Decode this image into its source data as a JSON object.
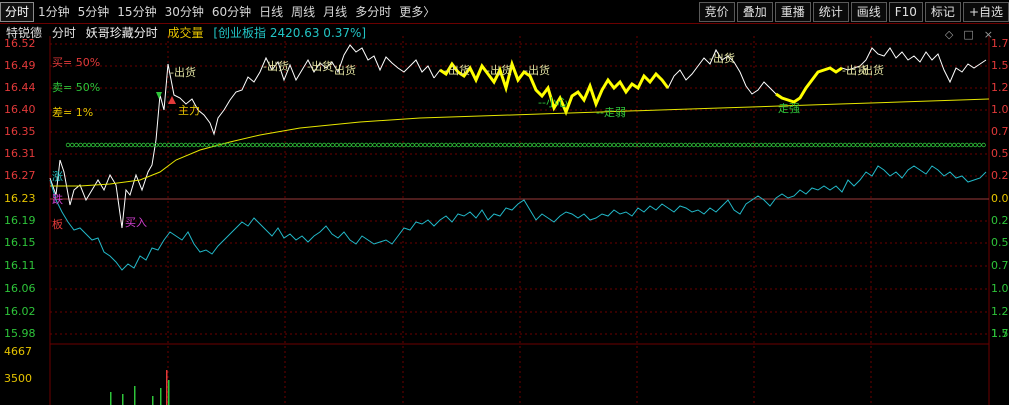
{
  "tabs": [
    "分时",
    "1分钟",
    "5分钟",
    "15分钟",
    "30分钟",
    "60分钟",
    "日线",
    "周线",
    "月线",
    "多分时",
    "更多〉"
  ],
  "tools": [
    "竞价",
    "叠加",
    "重播",
    "统计",
    "画线",
    "F10",
    "标记",
    "+自选"
  ],
  "header": {
    "stock_name": "特锐德",
    "period": "分时",
    "indicator": "妖哥珍藏分时",
    "volume_label": "成交量",
    "index_info": "[创业板指 2420.63 0.37%]"
  },
  "window_buttons": [
    "◇",
    "□",
    "×"
  ],
  "price_axis": {
    "labels": [
      "16.52",
      "16.49",
      "16.44",
      "16.40",
      "16.35",
      "16.31",
      "16.27",
      "16.23",
      "16.19",
      "16.15",
      "16.11",
      "16.06",
      "16.02",
      "15.98"
    ],
    "colors": {
      "up": "#e23a3a",
      "base": "#e6c400",
      "down": "#2ec43a"
    }
  },
  "volume_axis": {
    "labels": [
      "4667",
      "3500"
    ]
  },
  "pct_axis": {
    "labels": [
      "1.7",
      "1.5",
      "1.2",
      "1.0",
      "0.7",
      "0.5",
      "0.2",
      "0.0",
      "0.2",
      "0.5",
      "0.7",
      "1.0",
      "1.2",
      "1.5",
      "1.7"
    ]
  },
  "signals": {
    "buy_pct": "买= 50%",
    "sell_pct": "卖= 50%",
    "diff_pct": "差= 1%",
    "chu_huo": "出货",
    "mai_ru": "买入",
    "zhu_li": "主力",
    "xiao_huo": "--小心",
    "zou_ruo": "--走弱",
    "zou_qiang": "走强",
    "zhang": "涨",
    "die": "跌",
    "ban": "板"
  },
  "colors": {
    "price_line": "#ffffff",
    "avg_line": "#e6e600",
    "index_line": "#22b8c8",
    "grid": "#6b0000",
    "circles": "#2ec43a",
    "highlight": "#ffff00"
  }
}
